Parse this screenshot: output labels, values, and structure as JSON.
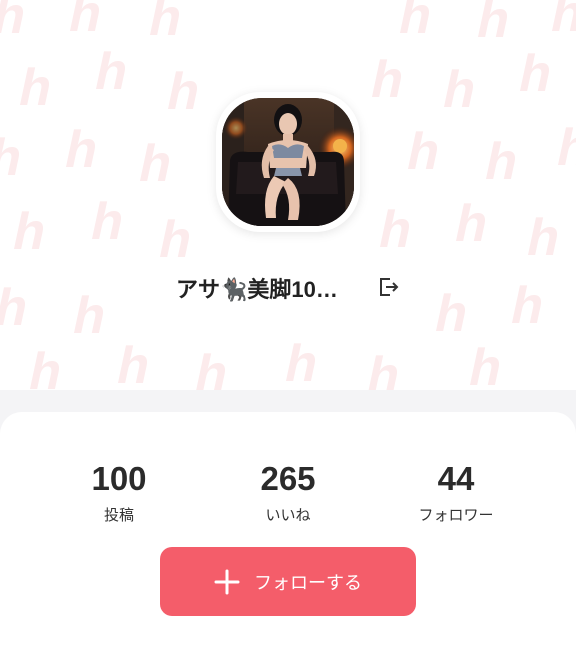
{
  "profile": {
    "display_name": "アサ🐈‍⬛美脚10…",
    "avatar_alt": "profile photo",
    "share_icon": "share-exit-icon"
  },
  "stats": [
    {
      "value": "100",
      "label": "投稿"
    },
    {
      "value": "265",
      "label": "いいね"
    },
    {
      "value": "44",
      "label": "フォロワー"
    }
  ],
  "follow_button": {
    "label": "フォローする",
    "icon": "plus-icon"
  },
  "colors": {
    "accent": "#f45d6a",
    "pattern": "#fcebec",
    "text": "#222222",
    "background": "#f4f4f6"
  }
}
